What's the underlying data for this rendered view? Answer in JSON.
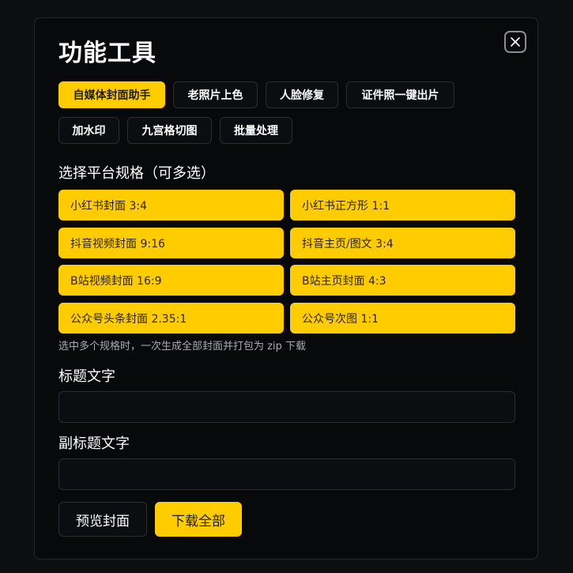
{
  "dialog": {
    "title": "功能工具"
  },
  "tabs": [
    {
      "label": "自媒体封面助手",
      "active": true
    },
    {
      "label": "老照片上色",
      "active": false
    },
    {
      "label": "人脸修复",
      "active": false
    },
    {
      "label": "证件照一键出片",
      "active": false
    },
    {
      "label": "加水印",
      "active": false
    },
    {
      "label": "九宫格切图",
      "active": false
    },
    {
      "label": "批量处理",
      "active": false
    }
  ],
  "platform": {
    "label": "选择平台规格（可多选）",
    "options": [
      {
        "label": "小红书封面 3:4",
        "selected": true
      },
      {
        "label": "小红书正方形 1:1",
        "selected": true
      },
      {
        "label": "抖音视频封面 9:16",
        "selected": true
      },
      {
        "label": "抖音主页/图文 3:4",
        "selected": true
      },
      {
        "label": "B站视频封面 16:9",
        "selected": true
      },
      {
        "label": "B站主页封面 4:3",
        "selected": true
      },
      {
        "label": "公众号头条封面 2.35:1",
        "selected": true
      },
      {
        "label": "公众号次图 1:1",
        "selected": true
      }
    ],
    "hint": "选中多个规格时，一次生成全部封面并打包为 zip 下载"
  },
  "title_field": {
    "label": "标题文字",
    "value": "",
    "placeholder": ""
  },
  "subtitle_field": {
    "label": "副标题文字",
    "value": "",
    "placeholder": ""
  },
  "actions": {
    "preview_label": "预览封面",
    "download_label": "下载全部"
  },
  "colors": {
    "accent": "#ffcc00",
    "background": "#08090b",
    "border": "#2c2e33",
    "text": "#ffffff"
  },
  "icons": {
    "close": "close-icon"
  }
}
